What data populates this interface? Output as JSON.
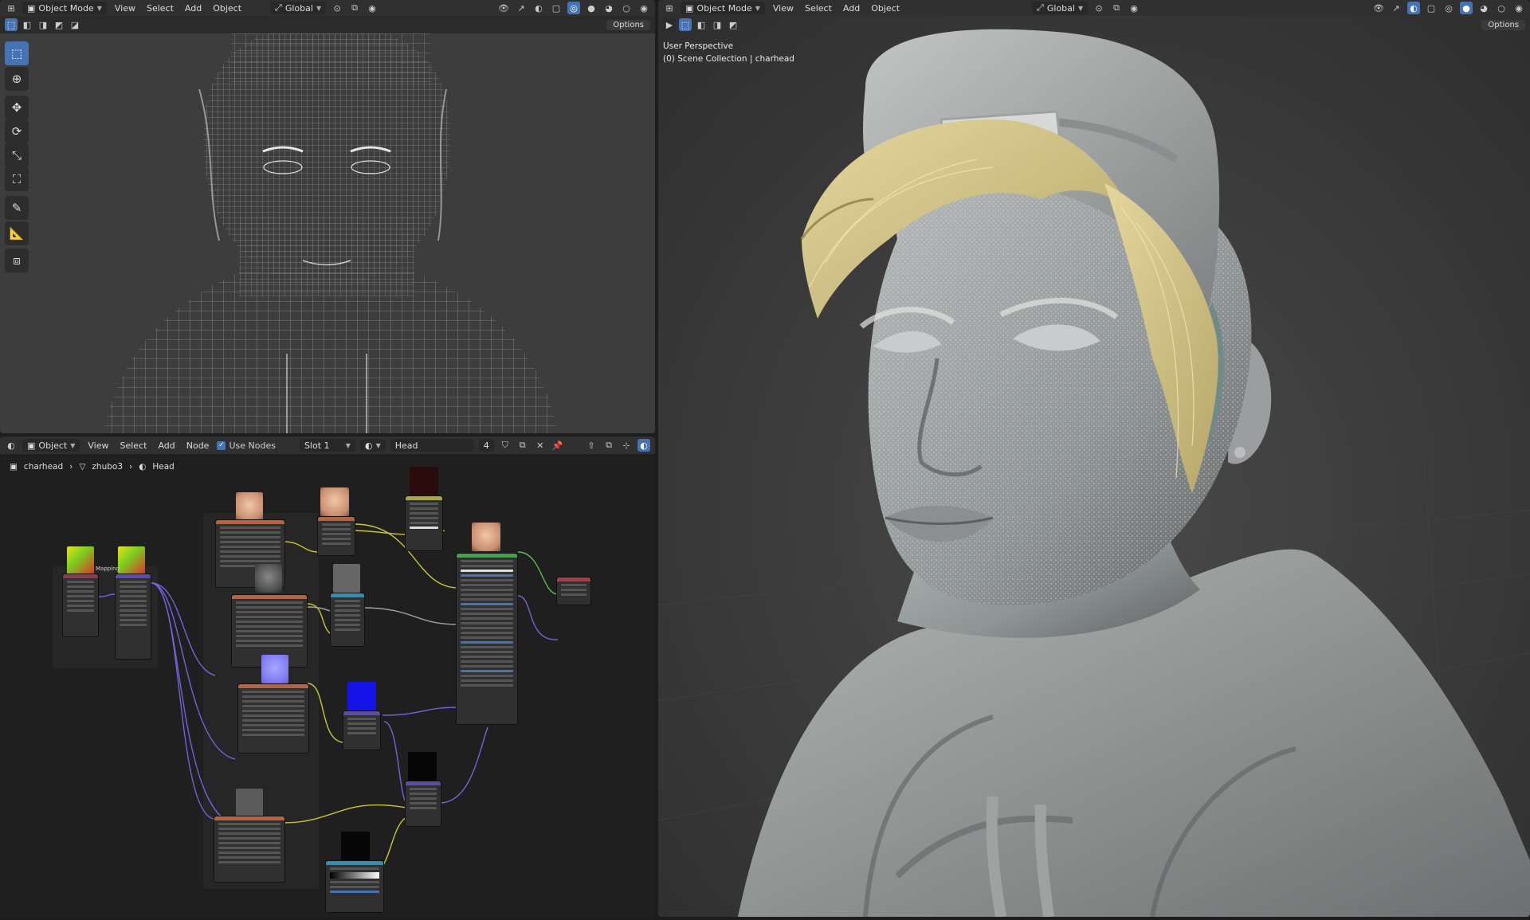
{
  "left_top": {
    "mode": "Object Mode",
    "menus": [
      "View",
      "Select",
      "Add",
      "Object"
    ],
    "orientation": "Global",
    "options": "Options"
  },
  "right_top": {
    "mode": "Object Mode",
    "menus": [
      "View",
      "Select",
      "Add",
      "Object"
    ],
    "orientation": "Global",
    "options": "Options",
    "overlay_line1": "User Perspective",
    "overlay_line2": "(0) Scene Collection | charhead"
  },
  "node_editor": {
    "type": "Object",
    "menus": [
      "View",
      "Select",
      "Add",
      "Node"
    ],
    "use_nodes": "Use Nodes",
    "slot": "Slot 1",
    "material": "Head",
    "users": "4",
    "breadcrumb": [
      "charhead",
      "zhubo3",
      "Head"
    ],
    "mapping_label": "Mapping"
  },
  "colors": {
    "accent": "#4772b3",
    "hair": "#d8c98f",
    "header": "#303030"
  }
}
